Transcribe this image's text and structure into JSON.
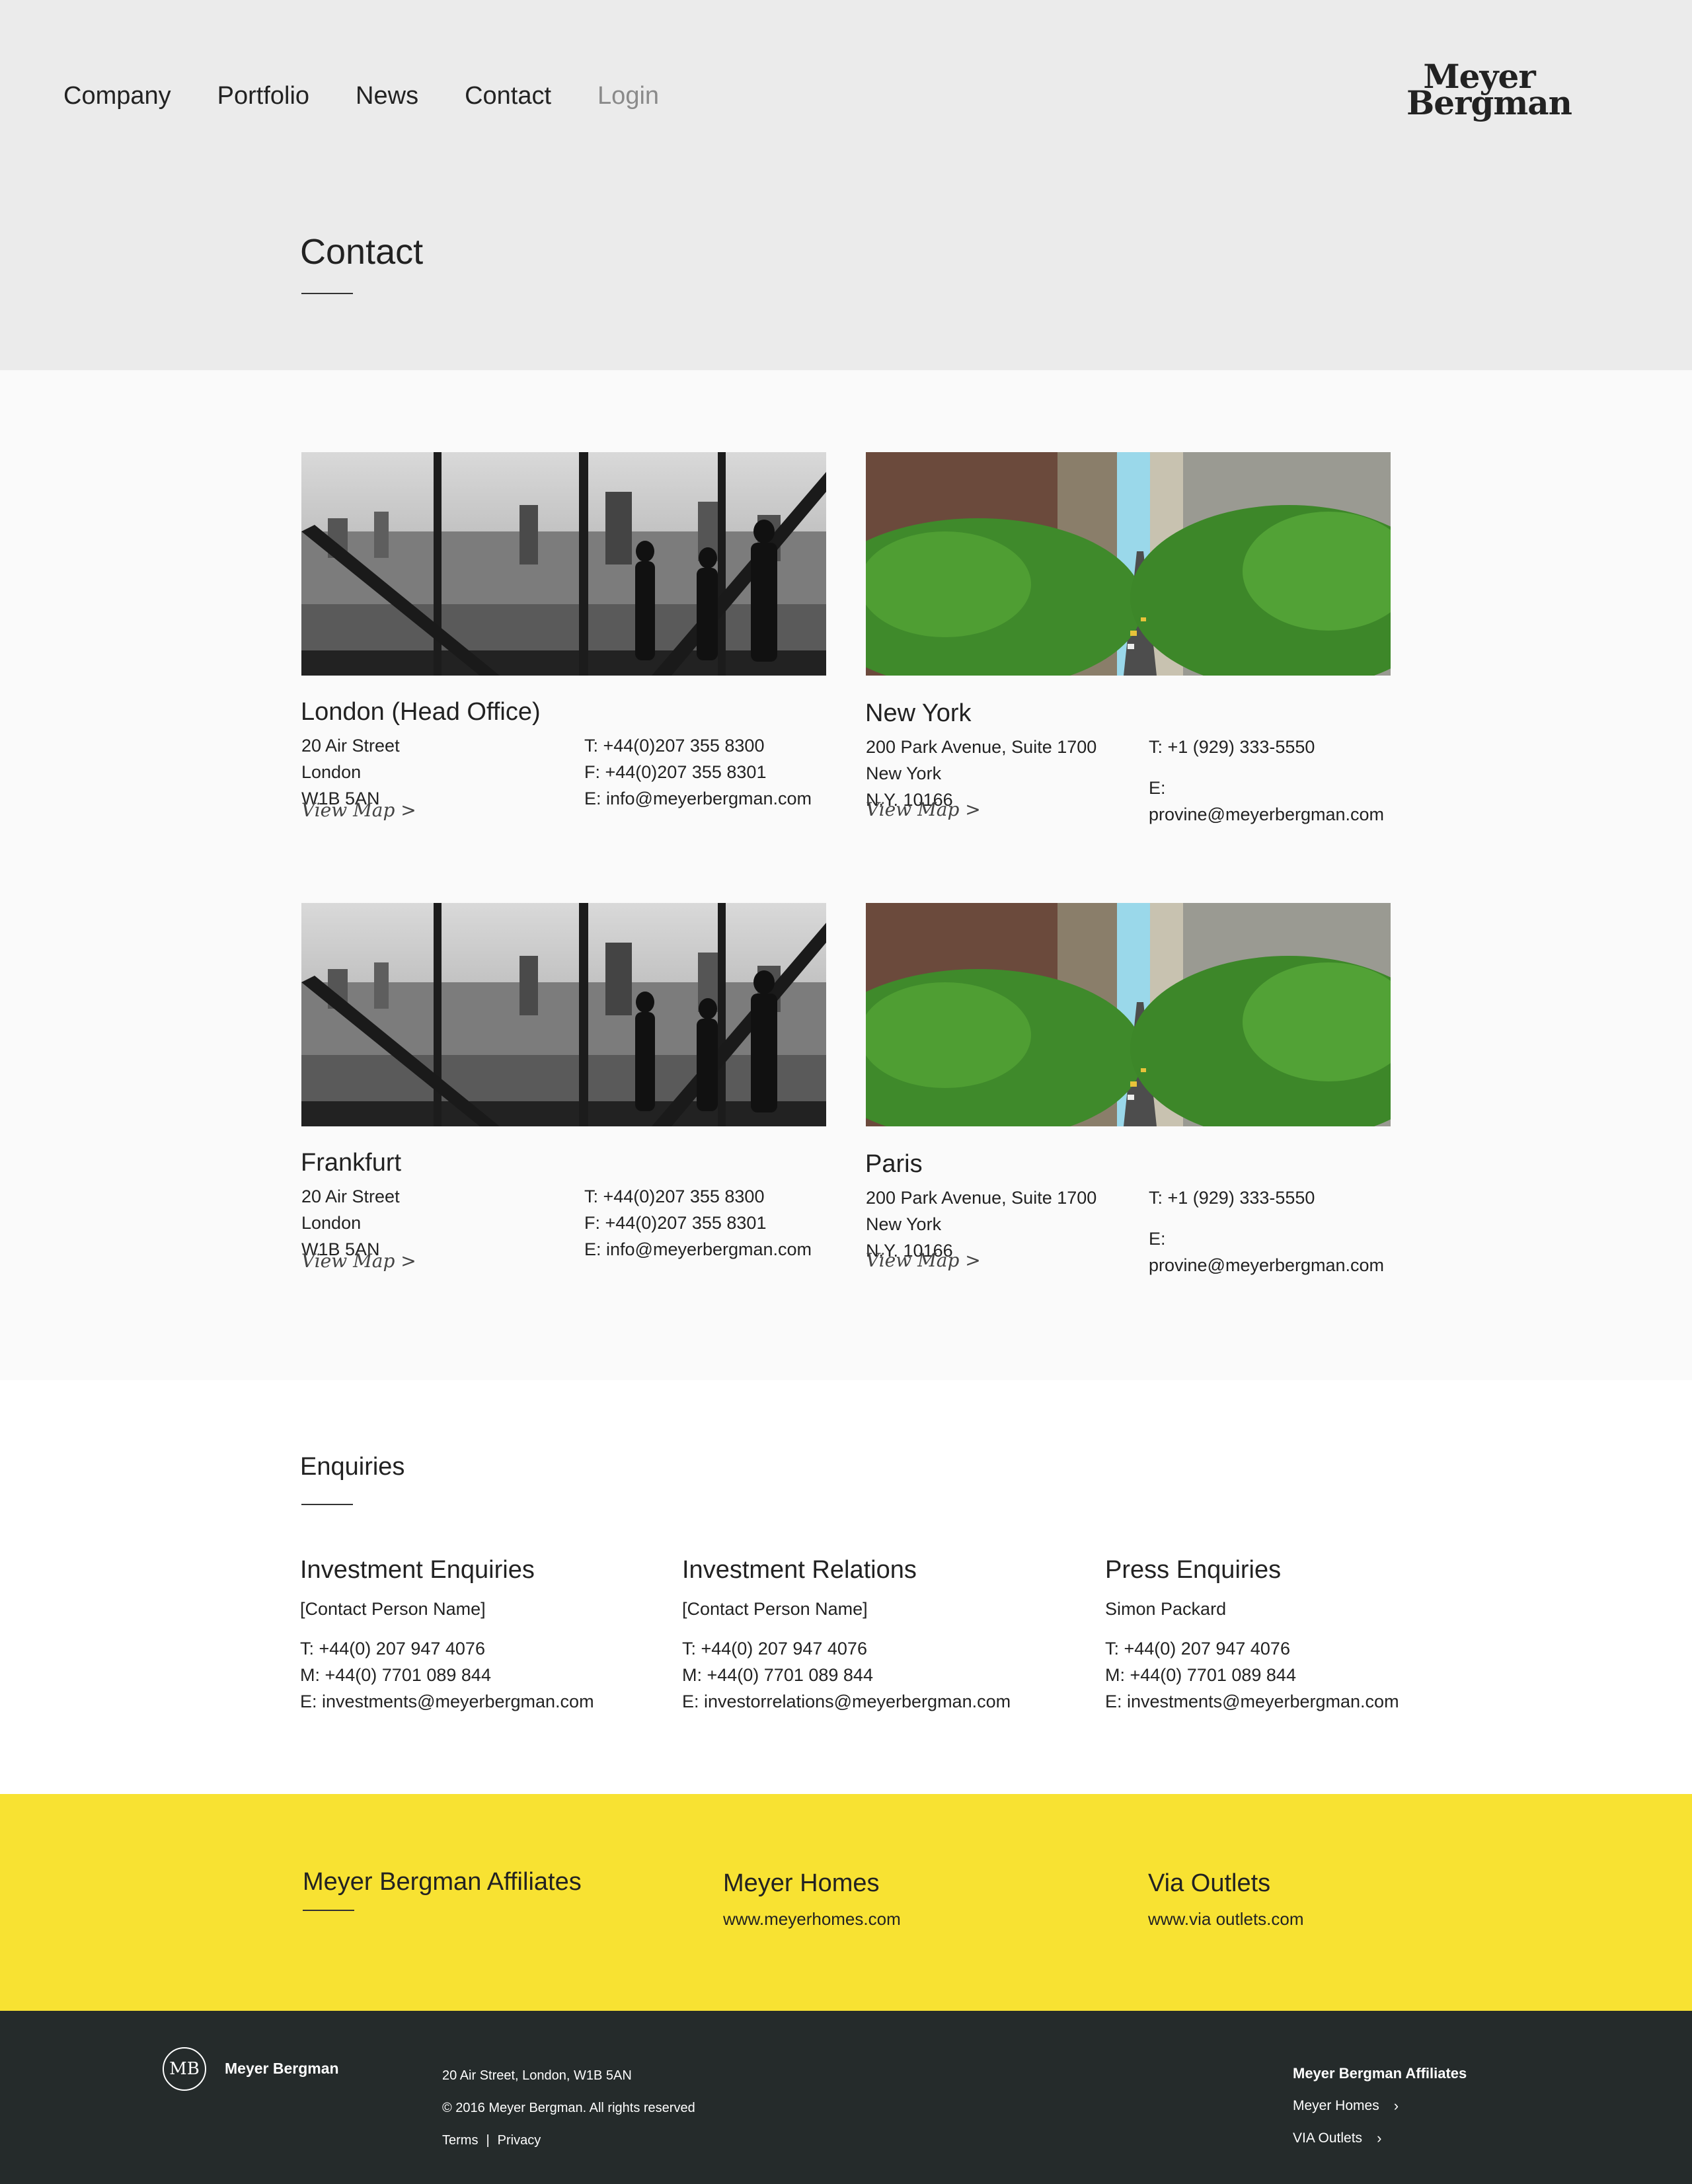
{
  "nav": {
    "items": [
      "Company",
      "Portfolio",
      "News",
      "Contact",
      "Login"
    ],
    "logo_line1": "Meyer",
    "logo_line2": "Bergman"
  },
  "page": {
    "title": "Contact"
  },
  "offices": [
    {
      "name": "London (Head Office)",
      "address": [
        "20 Air Street",
        "London",
        "W1B 5AN"
      ],
      "contact": [
        "T: +44(0)207 355 8300",
        "F: +44(0)207 355 8301",
        "E: info@meyerbergman.com"
      ],
      "map_label": "View Map >",
      "photo": "office-silhouette-photo"
    },
    {
      "name": "New York",
      "address": [
        "200 Park Avenue, Suite 1700",
        "New York",
        "N.Y. 10166"
      ],
      "contact": [
        "T: +1 (929) 333-5550",
        "E: provine@meyerbergman.com"
      ],
      "map_label": "View Map >",
      "photo": "city-street-photo"
    },
    {
      "name": "Frankfurt",
      "address": [
        "20 Air Street",
        "London",
        "W1B 5AN"
      ],
      "contact": [
        "T: +44(0)207 355 8300",
        "F: +44(0)207 355 8301",
        "E: info@meyerbergman.com"
      ],
      "map_label": "View Map >",
      "photo": "office-silhouette-photo"
    },
    {
      "name": "Paris",
      "address": [
        "200 Park Avenue, Suite 1700",
        "New York",
        "N.Y. 10166"
      ],
      "contact": [
        "T: +1 (929) 333-5550",
        "E: provine@meyerbergman.com"
      ],
      "map_label": "View Map >",
      "photo": "city-street-photo"
    }
  ],
  "enquiries": {
    "title": "Enquiries",
    "columns": [
      {
        "heading": "Investment Enquiries",
        "person": "[Contact Person Name]",
        "lines": [
          "T: +44(0) 207 947 4076",
          "M: +44(0) 7701 089 844",
          "E: investments@meyerbergman.com"
        ]
      },
      {
        "heading": "Investment Relations",
        "person": "[Contact Person Name]",
        "lines": [
          "T: +44(0) 207 947 4076",
          "M: +44(0) 7701 089 844",
          "E: investorrelations@meyerbergman.com"
        ]
      },
      {
        "heading": "Press Enquiries",
        "person": "Simon Packard",
        "lines": [
          "T: +44(0) 207 947 4076",
          "M: +44(0) 7701 089 844",
          "E: investments@meyerbergman.com"
        ]
      }
    ]
  },
  "affiliates": {
    "title": "Meyer Bergman Affiliates",
    "items": [
      {
        "name": "Meyer Homes",
        "url": "www.meyerhomes.com"
      },
      {
        "name": "Via Outlets",
        "url": "www.via outlets.com"
      }
    ]
  },
  "footer": {
    "monogram": "MB",
    "brand": "Meyer Bergman",
    "address": "20 Air Street, London, W1B 5AN",
    "copyright": "© 2016 Meyer Bergman. All rights reserved",
    "links": [
      "Terms",
      "Privacy"
    ],
    "link_separator": "|",
    "affiliates_title": "Meyer Bergman Affiliates",
    "affiliates": [
      "Meyer Homes",
      "VIA Outlets"
    ],
    "chevron": "›"
  },
  "colors": {
    "header_bg": "#ebebeb",
    "offices_bg": "#fafafa",
    "affiliates_bg": "#f8e232",
    "footer_bg": "#252b2b",
    "muted_nav": "#8a8a8a"
  }
}
